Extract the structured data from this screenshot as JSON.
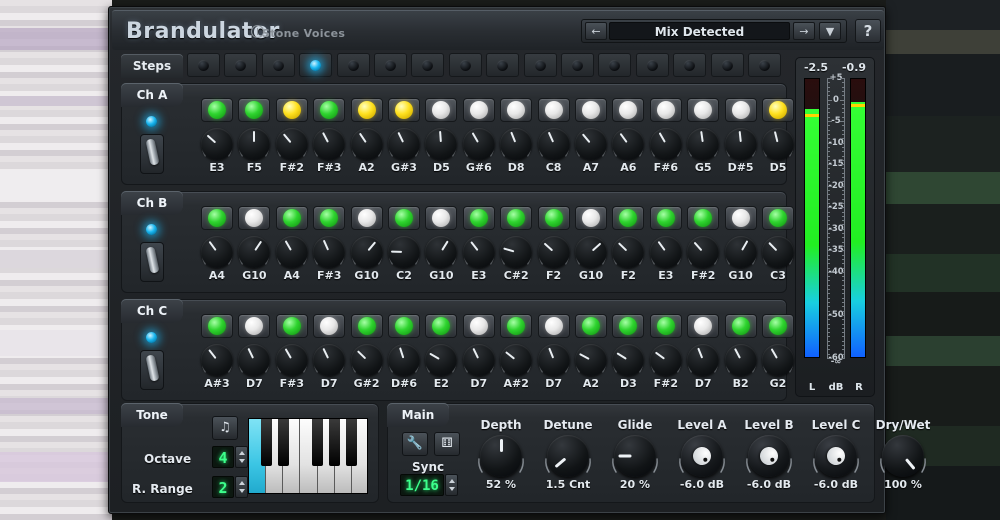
{
  "window": {
    "brand": "Brandulator",
    "vendor": "Stone Voices",
    "help_label": "?"
  },
  "preset_bar": {
    "prev_label": "←",
    "name": "Mix Detected",
    "next_label": "→",
    "menu_label": "▼"
  },
  "steps": {
    "label": "Steps",
    "count": 16,
    "active_index": 3
  },
  "channels": [
    {
      "tab": "Ch A",
      "enabled": true,
      "leds": [
        "green",
        "green",
        "yellow",
        "green",
        "yellow",
        "yellow",
        "white",
        "white",
        "white",
        "white",
        "white",
        "white",
        "white",
        "white",
        "white",
        "yellow"
      ],
      "notes": [
        "E3",
        "F5",
        "F#2",
        "F#3",
        "A2",
        "G#3",
        "D5",
        "G#6",
        "D8",
        "C8",
        "A7",
        "A6",
        "F#6",
        "G5",
        "D#5",
        "D5"
      ],
      "knob_angles": [
        -48,
        0,
        -40,
        -28,
        -34,
        -26,
        -4,
        -30,
        -22,
        -24,
        -40,
        -36,
        -30,
        -8,
        -6,
        -14
      ]
    },
    {
      "tab": "Ch B",
      "enabled": true,
      "leds": [
        "green",
        "white",
        "green",
        "green",
        "white",
        "green",
        "white",
        "green",
        "green",
        "green",
        "white",
        "green",
        "green",
        "green",
        "white",
        "green"
      ],
      "notes": [
        "A4",
        "G10",
        "A4",
        "F#3",
        "G10",
        "C2",
        "G10",
        "E3",
        "C#2",
        "F2",
        "G10",
        "F2",
        "E3",
        "F#2",
        "G10",
        "C3"
      ],
      "knob_angles": [
        -36,
        34,
        -30,
        -24,
        40,
        -88,
        32,
        -38,
        -74,
        -48,
        48,
        -46,
        -36,
        -42,
        30,
        -44
      ]
    },
    {
      "tab": "Ch C",
      "enabled": true,
      "leds": [
        "green",
        "white",
        "green",
        "white",
        "green",
        "green",
        "green",
        "white",
        "green",
        "white",
        "green",
        "green",
        "green",
        "white",
        "green",
        "green"
      ],
      "notes": [
        "A#3",
        "D7",
        "F#3",
        "D7",
        "G#2",
        "D#6",
        "E2",
        "D7",
        "A#2",
        "D7",
        "A2",
        "D3",
        "F#2",
        "D7",
        "B2",
        "G2"
      ],
      "knob_angles": [
        -38,
        -26,
        -30,
        -26,
        -46,
        -18,
        -60,
        -26,
        -52,
        -22,
        -62,
        -58,
        -54,
        -22,
        -28,
        -30
      ]
    }
  ],
  "meter": {
    "left_value": "-2.5",
    "right_value": "-0.9",
    "left_label": "L",
    "right_label": "R",
    "unit_label": "dB",
    "scale_labels": [
      "+5",
      "0",
      "-5",
      "-10",
      "-15",
      "-20",
      "-25",
      "-30",
      "-35",
      "-40",
      "-50",
      "-60",
      "-∞"
    ],
    "left_level_db": -2.5,
    "right_level_db": -0.9,
    "left_peak_db": -3.2,
    "right_peak_db": -0.9
  },
  "tone": {
    "tab": "Tone",
    "note_icon_label": "♫",
    "octave_label": "Octave",
    "octave_value": "4",
    "range_label": "R. Range",
    "range_value": "2",
    "selected_key_index": 0
  },
  "main": {
    "tab": "Main",
    "wrench_icon_label": "🔧",
    "dice_icon_label": "⚅",
    "sync_label": "Sync",
    "sync_value": "1/16",
    "knobs": [
      {
        "title": "Depth",
        "value": "52 %",
        "angle": 0,
        "style": "plain"
      },
      {
        "title": "Detune",
        "value": "1.5 Cnt",
        "angle": -130,
        "style": "plain"
      },
      {
        "title": "Glide",
        "value": "20 %",
        "angle": -90,
        "style": "plain"
      },
      {
        "title": "Level A",
        "value": "-6.0 dB",
        "angle": 85,
        "style": "cap"
      },
      {
        "title": "Level B",
        "value": "-6.0 dB",
        "angle": 85,
        "style": "cap"
      },
      {
        "title": "Level C",
        "value": "-6.0 dB",
        "angle": 85,
        "style": "cap"
      },
      {
        "title": "Dry/Wet",
        "value": "100 %",
        "angle": 140,
        "style": "plain"
      }
    ]
  },
  "colors": {
    "accent_cyan": "#18b6f0",
    "led_green": "#2fd42f",
    "led_yellow": "#ffe11f",
    "led_white": "#e8e8e8",
    "lcd_green": "#3dff8c",
    "panel_bg": "#292d31"
  }
}
